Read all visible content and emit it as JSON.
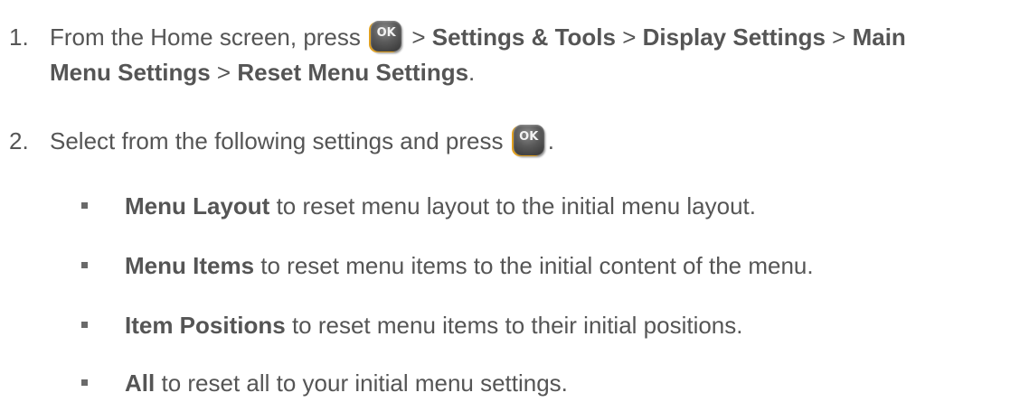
{
  "steps": [
    {
      "number": "1.",
      "line1": {
        "prefix": "From the Home screen, press",
        "sep1": ">",
        "item1": "Settings & Tools",
        "sep2": ">",
        "item2": "Display Settings",
        "sep3": ">",
        "item3": "Main"
      },
      "line2": {
        "item3_cont": "Menu Settings",
        "sep4": ">",
        "item4": "Reset Menu Settings",
        "end": "."
      }
    },
    {
      "number": "2.",
      "text": "Select from the following settings and press",
      "end": "."
    }
  ],
  "ok_key": {
    "label": "OK",
    "icon": "ok-key-icon"
  },
  "bullets": [
    {
      "term": "Menu Layout",
      "desc": "to reset menu layout to the initial menu layout."
    },
    {
      "term": "Menu Items",
      "desc": "to reset menu items to the initial content of the menu."
    },
    {
      "term": "Item Positions",
      "desc": "to reset menu items to their initial positions."
    },
    {
      "term": "All",
      "desc": "to reset all to your initial menu settings."
    }
  ],
  "colors": {
    "text": "#555555",
    "key_face": "#5a5a5a",
    "key_accent": "#e0a020"
  }
}
